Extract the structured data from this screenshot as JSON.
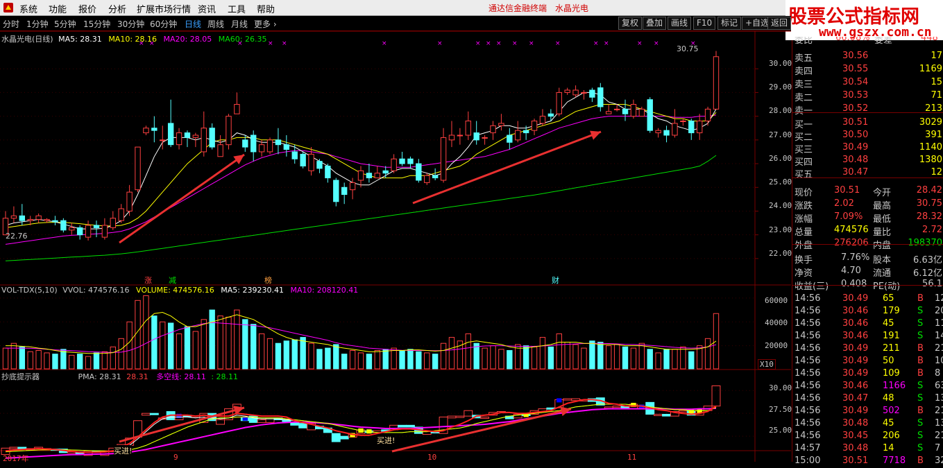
{
  "menu": {
    "items": [
      "系统",
      "功能",
      "报价",
      "分析",
      "扩展市场行情",
      "资讯",
      "工具",
      "帮助"
    ],
    "app_title": "通达信金融终端",
    "stock_title": "水晶光电"
  },
  "logo": {
    "line1": "股票公式指标网",
    "line2": "www.gszx.com.cn"
  },
  "toolbar": {
    "periods": [
      "分时",
      "1分钟",
      "5分钟",
      "15分钟",
      "30分钟",
      "60分钟",
      "日线",
      "周线",
      "月线",
      "更多 ›"
    ],
    "active_period": "日线",
    "buttons": [
      "复权",
      "叠加",
      "画线",
      "F10",
      "标记",
      "+自选",
      "返回"
    ]
  },
  "main_chart": {
    "title": "水晶光电(日线)",
    "ma5": "MA5: 28.31",
    "ma10": "MA10: 28.16",
    "ma20": "MA20: 28.05",
    "ma60": "MA60: 26.35",
    "high_label": "30.75",
    "low_label": "22.76",
    "event_markers": [
      "涨",
      "减",
      "榜",
      "财"
    ],
    "y_ticks": [
      "30.00",
      "29.00",
      "28.00",
      "27.00",
      "26.00",
      "25.00",
      "24.00",
      "23.00",
      "22.00"
    ]
  },
  "volume_panel": {
    "title": "VOL-TDX(5,10)",
    "vvol": "VVOL: 474576.16",
    "volume": "VOLUME: 474576.16",
    "ma5": "MA5: 239230.41",
    "ma10": "MA10: 208120.41",
    "y_ticks": [
      "60000",
      "40000",
      "20000"
    ],
    "unit": "X10"
  },
  "indicator_panel": {
    "title": "抄底提示器",
    "pma": "PMA: 28.31",
    "pma_val2": "28.31",
    "dk_label": "多空线: 28.11",
    "dk_val2": ": 28.11",
    "buy_signals": [
      "买进!",
      "买进!"
    ],
    "y_ticks": [
      "30.00",
      "27.50",
      "25.00"
    ]
  },
  "x_axis": {
    "labels": [
      "2017年",
      "9",
      "10",
      "11"
    ]
  },
  "quote_panel": {
    "header_partial": [
      "委比",
      "66.08%",
      "委差",
      "448"
    ],
    "sell": [
      {
        "label": "卖五",
        "price": "30.56",
        "vol": "17"
      },
      {
        "label": "卖四",
        "price": "30.55",
        "vol": "1169"
      },
      {
        "label": "卖三",
        "price": "30.54",
        "vol": "15"
      },
      {
        "label": "卖二",
        "price": "30.53",
        "vol": "71"
      },
      {
        "label": "卖一",
        "price": "30.52",
        "vol": "213"
      }
    ],
    "buy": [
      {
        "label": "买一",
        "price": "30.51",
        "vol": "3029"
      },
      {
        "label": "买二",
        "price": "30.50",
        "vol": "391"
      },
      {
        "label": "买三",
        "price": "30.49",
        "vol": "1140"
      },
      {
        "label": "买四",
        "price": "30.48",
        "vol": "1380"
      },
      {
        "label": "买五",
        "price": "30.47",
        "vol": "12"
      }
    ],
    "stats": [
      {
        "l1": "现价",
        "v1": "30.51",
        "l2": "今开",
        "v2": "28.42"
      },
      {
        "l1": "涨跌",
        "v1": "2.02",
        "l2": "最高",
        "v2": "30.75"
      },
      {
        "l1": "涨幅",
        "v1": "7.09%",
        "l2": "最低",
        "v2": "28.32"
      },
      {
        "l1": "总量",
        "v1": "474576",
        "l2": "量比",
        "v2": "2.72"
      },
      {
        "l1": "外盘",
        "v1": "276206",
        "l2": "内盘",
        "v2": "198370"
      }
    ],
    "fin": [
      {
        "l1": "换手",
        "v1": "7.76%",
        "l2": "股本",
        "v2": "6.63亿"
      },
      {
        "l1": "净资",
        "v1": "4.70",
        "l2": "流通",
        "v2": "6.12亿"
      },
      {
        "l1": "收益(三)",
        "v1": "0.408",
        "l2": "PE(动)",
        "v2": "56.1"
      }
    ],
    "ticks": [
      {
        "t": "14:56",
        "p": "30.49",
        "v": "65",
        "d": "B",
        "n": "12"
      },
      {
        "t": "14:56",
        "p": "30.46",
        "v": "179",
        "d": "S",
        "n": "20"
      },
      {
        "t": "14:56",
        "p": "30.46",
        "v": "45",
        "d": "S",
        "n": "11"
      },
      {
        "t": "14:56",
        "p": "30.46",
        "v": "191",
        "d": "S",
        "n": "14"
      },
      {
        "t": "14:56",
        "p": "30.49",
        "v": "211",
        "d": "B",
        "n": "21"
      },
      {
        "t": "14:56",
        "p": "30.49",
        "v": "50",
        "d": "B",
        "n": "10"
      },
      {
        "t": "14:56",
        "p": "30.49",
        "v": "109",
        "d": "B",
        "n": "8"
      },
      {
        "t": "14:56",
        "p": "30.46",
        "v": "1166",
        "d": "S",
        "n": "63"
      },
      {
        "t": "14:56",
        "p": "30.47",
        "v": "48",
        "d": "S",
        "n": "13"
      },
      {
        "t": "14:56",
        "p": "30.49",
        "v": "502",
        "d": "B",
        "n": "21"
      },
      {
        "t": "14:56",
        "p": "30.48",
        "v": "45",
        "d": "S",
        "n": "13"
      },
      {
        "t": "14:56",
        "p": "30.45",
        "v": "206",
        "d": "S",
        "n": "21"
      },
      {
        "t": "14:57",
        "p": "30.48",
        "v": "14",
        "d": "S",
        "n": "7"
      },
      {
        "t": "15:00",
        "p": "30.51",
        "v": "7718",
        "d": "B",
        "n": "32"
      }
    ]
  },
  "colors": {
    "up": "#ff4040",
    "down": "#54ffff",
    "ma5": "#ffffff",
    "ma10": "#ffff00",
    "ma20": "#ff00ff",
    "ma60": "#00e000",
    "panel_border": "#7a0000",
    "arrow": "#e83030"
  },
  "chart_data": {
    "type": "candlestick",
    "title": "水晶光电(日线)",
    "candles": [
      [
        23.0,
        23.7,
        23.0,
        24.0
      ],
      [
        23.7,
        23.8,
        23.5,
        24.2
      ],
      [
        23.8,
        23.6,
        23.4,
        24.3
      ],
      [
        23.6,
        23.65,
        23.4,
        23.8
      ],
      [
        23.65,
        23.8,
        23.5,
        23.9
      ],
      [
        23.6,
        23.65,
        23.5,
        23.7
      ],
      [
        23.6,
        23.55,
        23.4,
        23.8
      ],
      [
        23.6,
        23.2,
        23.1,
        23.7
      ],
      [
        23.2,
        23.3,
        23.0,
        23.5
      ],
      [
        23.3,
        23.0,
        22.8,
        23.4
      ],
      [
        22.9,
        23.4,
        22.76,
        23.6
      ],
      [
        23.4,
        23.3,
        22.9,
        23.6
      ],
      [
        22.9,
        23.4,
        22.8,
        23.7
      ],
      [
        23.3,
        23.7,
        23.2,
        24.0
      ],
      [
        23.6,
        24.1,
        23.5,
        24.3
      ],
      [
        24.0,
        24.8,
        23.8,
        25.1
      ],
      [
        24.9,
        26.7,
        24.8,
        26.7
      ],
      [
        27.3,
        27.5,
        27.2,
        27.6
      ],
      [
        27.5,
        27.4,
        26.9,
        28.0
      ],
      [
        27.0,
        27.0,
        26.6,
        27.6
      ],
      [
        27.7,
        26.8,
        26.7,
        28.7
      ],
      [
        26.8,
        27.3,
        26.6,
        27.5
      ],
      [
        27.3,
        27.1,
        26.7,
        27.4
      ],
      [
        27.1,
        27.2,
        26.7,
        27.3
      ],
      [
        26.5,
        27.5,
        26.3,
        28.2
      ],
      [
        27.5,
        26.7,
        26.6,
        27.7
      ],
      [
        26.3,
        26.8,
        26.3,
        27.2
      ],
      [
        26.8,
        28.0,
        26.6,
        28.1
      ],
      [
        28.1,
        28.5,
        28.1,
        29.0
      ],
      [
        27.0,
        26.7,
        26.5,
        27.2
      ],
      [
        27.2,
        26.5,
        26.1,
        27.4
      ],
      [
        26.5,
        26.8,
        26.3,
        27.0
      ],
      [
        26.5,
        27.0,
        26.4,
        27.1
      ],
      [
        27.0,
        26.8,
        26.4,
        27.5
      ],
      [
        26.8,
        26.6,
        26.3,
        27.2
      ],
      [
        26.5,
        26.2,
        26.0,
        26.8
      ],
      [
        26.4,
        25.9,
        25.8,
        26.5
      ],
      [
        25.7,
        26.4,
        25.5,
        26.7
      ],
      [
        26.1,
        25.8,
        25.6,
        26.2
      ],
      [
        25.9,
        25.4,
        25.2,
        26.0
      ],
      [
        25.3,
        24.4,
        24.2,
        25.4
      ],
      [
        25.0,
        24.7,
        24.3,
        25.2
      ],
      [
        24.9,
        25.2,
        24.5,
        25.4
      ],
      [
        25.3,
        25.7,
        25.0,
        25.9
      ],
      [
        25.6,
        25.4,
        25.2,
        26.0
      ],
      [
        25.4,
        25.6,
        25.4,
        25.9
      ],
      [
        25.7,
        25.6,
        25.4,
        25.9
      ],
      [
        25.7,
        26.2,
        25.6,
        26.4
      ],
      [
        26.2,
        26.0,
        25.9,
        26.5
      ],
      [
        26.2,
        26.0,
        25.8,
        26.3
      ],
      [
        26.0,
        25.3,
        25.2,
        26.2
      ],
      [
        25.2,
        25.5,
        25.1,
        25.6
      ],
      [
        25.5,
        25.4,
        25.3,
        25.8
      ],
      [
        25.3,
        27.1,
        25.2,
        27.5
      ],
      [
        27.0,
        27.2,
        26.7,
        27.8
      ],
      [
        27.2,
        27.2,
        26.8,
        27.5
      ],
      [
        27.2,
        27.8,
        27.0,
        28.2
      ],
      [
        27.3,
        27.0,
        26.8,
        27.8
      ],
      [
        27.1,
        27.1,
        26.8,
        27.2
      ],
      [
        27.3,
        27.6,
        27.0,
        27.8
      ],
      [
        27.6,
        27.7,
        27.4,
        28.1
      ],
      [
        27.2,
        26.9,
        26.6,
        27.5
      ],
      [
        27.0,
        27.4,
        26.9,
        27.8
      ],
      [
        27.4,
        27.3,
        27.0,
        27.6
      ],
      [
        27.4,
        27.8,
        27.2,
        27.9
      ],
      [
        27.7,
        28.0,
        27.6,
        28.3
      ],
      [
        28.1,
        28.0,
        27.8,
        28.3
      ],
      [
        28.1,
        29.0,
        28.0,
        29.2
      ],
      [
        29.0,
        29.1,
        28.9,
        29.2
      ],
      [
        28.9,
        29.1,
        28.8,
        29.3
      ],
      [
        29.0,
        29.0,
        28.7,
        29.1
      ],
      [
        29.1,
        28.8,
        28.6,
        29.2
      ],
      [
        29.2,
        28.4,
        28.2,
        29.4
      ],
      [
        28.1,
        28.2,
        28.1,
        28.5
      ],
      [
        28.3,
        28.3,
        28.2,
        28.5
      ],
      [
        28.3,
        28.1,
        27.8,
        28.7
      ],
      [
        28.0,
        28.5,
        27.9,
        28.7
      ],
      [
        28.0,
        28.3,
        28.0,
        28.4
      ],
      [
        28.7,
        27.4,
        27.3,
        28.8
      ],
      [
        27.3,
        27.4,
        27.1,
        27.5
      ],
      [
        27.4,
        27.2,
        26.9,
        27.6
      ],
      [
        27.2,
        27.7,
        27.1,
        28.3
      ],
      [
        27.8,
        27.8,
        27.6,
        27.9
      ],
      [
        27.8,
        27.3,
        27.0,
        27.9
      ],
      [
        27.3,
        27.8,
        27.0,
        28.1
      ],
      [
        27.8,
        28.3,
        27.6,
        28.4
      ],
      [
        28.3,
        30.51,
        28.32,
        30.75
      ]
    ],
    "ma5": [
      23.4,
      23.5,
      23.55,
      23.6,
      23.65,
      23.6,
      23.55,
      23.45,
      23.35,
      23.25,
      23.25,
      23.25,
      23.28,
      23.4,
      23.6,
      24.0,
      24.7,
      25.5,
      26.3,
      26.9,
      27.1,
      27.1,
      27.1,
      27.0,
      27.1,
      27.0,
      26.9,
      27.0,
      27.3,
      27.2,
      27.0,
      26.9,
      26.9,
      26.9,
      26.8,
      26.7,
      26.5,
      26.3,
      26.1,
      25.9,
      25.6,
      25.4,
      25.2,
      25.1,
      25.1,
      25.3,
      25.5,
      25.7,
      25.8,
      25.8,
      25.7,
      25.6,
      25.5,
      25.6,
      26.0,
      26.3,
      26.7,
      27.2,
      27.3,
      27.4,
      27.6,
      27.6,
      27.5,
      27.5,
      27.6,
      27.7,
      27.8,
      28.2,
      28.6,
      28.8,
      29.0,
      29.0,
      28.9,
      28.6,
      28.5,
      28.3,
      28.3,
      28.3,
      28.1,
      27.9,
      27.8,
      27.6,
      27.5,
      27.4,
      27.5,
      27.7,
      28.3
    ],
    "ma10": [
      23.3,
      23.35,
      23.4,
      23.45,
      23.5,
      23.52,
      23.53,
      23.53,
      23.5,
      23.47,
      23.43,
      23.4,
      23.38,
      23.37,
      23.4,
      23.5,
      23.7,
      24.0,
      24.4,
      24.8,
      25.2,
      25.6,
      26.0,
      26.3,
      26.6,
      26.9,
      27.0,
      27.0,
      27.1,
      27.1,
      27.1,
      27.0,
      27.0,
      27.0,
      26.9,
      26.8,
      26.7,
      26.6,
      26.5,
      26.4,
      26.2,
      26.0,
      25.8,
      25.6,
      25.5,
      25.4,
      25.4,
      25.4,
      25.4,
      25.5,
      25.5,
      25.5,
      25.6,
      25.7,
      25.8,
      25.9,
      26.1,
      26.4,
      26.6,
      26.8,
      27.0,
      27.2,
      27.3,
      27.4,
      27.5,
      27.6,
      27.7,
      27.8,
      28.0,
      28.2,
      28.3,
      28.4,
      28.5,
      28.5,
      28.5,
      28.5,
      28.4,
      28.3,
      28.2,
      28.1,
      28.0,
      27.9,
      27.9,
      27.8,
      27.8,
      27.8,
      28.16
    ],
    "ma20": [
      22.6,
      22.65,
      22.7,
      22.75,
      22.8,
      22.85,
      22.9,
      22.95,
      22.98,
      23.0,
      23.02,
      23.04,
      23.06,
      23.1,
      23.15,
      23.25,
      23.4,
      23.55,
      23.75,
      23.95,
      24.15,
      24.35,
      24.55,
      24.75,
      24.95,
      25.15,
      25.35,
      25.55,
      25.75,
      25.95,
      26.1,
      26.25,
      26.35,
      26.45,
      26.5,
      26.55,
      26.55,
      26.5,
      26.45,
      26.4,
      26.3,
      26.2,
      26.1,
      26.0,
      25.95,
      25.9,
      25.85,
      25.85,
      25.85,
      25.85,
      25.9,
      25.95,
      26.0,
      26.05,
      26.1,
      26.15,
      26.2,
      26.25,
      26.3,
      26.4,
      26.5,
      26.6,
      26.75,
      26.9,
      27.05,
      27.2,
      27.35,
      27.5,
      27.6,
      27.7,
      27.8,
      27.9,
      27.95,
      28.0,
      28.0,
      28.0,
      28.0,
      28.0,
      28.0,
      28.0,
      28.0,
      27.95,
      27.95,
      27.95,
      28.0,
      28.0,
      28.05
    ],
    "ma60": [
      21.9,
      21.92,
      21.94,
      21.96,
      21.98,
      22.0,
      22.02,
      22.04,
      22.06,
      22.08,
      22.1,
      22.12,
      22.14,
      22.17,
      22.2,
      22.24,
      22.28,
      22.33,
      22.38,
      22.43,
      22.48,
      22.53,
      22.58,
      22.63,
      22.68,
      22.73,
      22.78,
      22.83,
      22.88,
      22.93,
      22.98,
      23.03,
      23.08,
      23.13,
      23.18,
      23.23,
      23.28,
      23.33,
      23.38,
      23.43,
      23.48,
      23.53,
      23.58,
      23.63,
      23.68,
      23.73,
      23.78,
      23.83,
      23.88,
      23.93,
      23.98,
      24.03,
      24.08,
      24.13,
      24.18,
      24.23,
      24.28,
      24.33,
      24.38,
      24.43,
      24.48,
      24.53,
      24.58,
      24.63,
      24.68,
      24.74,
      24.8,
      24.86,
      24.92,
      24.98,
      25.04,
      25.1,
      25.16,
      25.22,
      25.28,
      25.34,
      25.4,
      25.46,
      25.52,
      25.58,
      25.64,
      25.7,
      25.76,
      25.82,
      25.9,
      26.1,
      26.35
    ],
    "volume": [
      18000,
      22000,
      19000,
      15000,
      16000,
      14000,
      13000,
      17000,
      12000,
      13000,
      11000,
      14000,
      15000,
      19000,
      26000,
      40000,
      58000,
      62000,
      45000,
      40000,
      39000,
      30000,
      36000,
      32000,
      42000,
      50000,
      45000,
      44000,
      50000,
      42000,
      38000,
      30000,
      26000,
      22000,
      24000,
      25000,
      27000,
      22000,
      17000,
      18000,
      21000,
      13000,
      16000,
      14000,
      13000,
      16000,
      17000,
      18000,
      16000,
      17000,
      15000,
      14000,
      13000,
      22000,
      27000,
      24000,
      30000,
      22000,
      18000,
      20000,
      17000,
      16000,
      21000,
      20000,
      19000,
      27000,
      19000,
      30000,
      23000,
      21000,
      18000,
      24000,
      23000,
      20000,
      21000,
      19000,
      18000,
      22000,
      17000,
      14000,
      17000,
      17000,
      19000,
      15000,
      20000,
      26000,
      47000
    ],
    "vol_ma5": [
      20000,
      20000,
      19500,
      19000,
      18000,
      17200,
      16000,
      15000,
      14500,
      14000,
      13500,
      13500,
      13600,
      14200,
      17000,
      23000,
      32000,
      41000,
      47000,
      48000,
      45000,
      40000,
      36000,
      36000,
      38000,
      40000,
      42000,
      44000,
      46000,
      44000,
      42000,
      38000,
      34000,
      30000,
      27000,
      25000,
      24000,
      23000,
      22000,
      21000,
      19000,
      18000,
      17000,
      16000,
      15000,
      15000,
      15500,
      16000,
      16000,
      16500,
      16500,
      16000,
      15500,
      16000,
      18000,
      20000,
      23000,
      24000,
      23000,
      22000,
      21000,
      19000,
      18000,
      18000,
      19000,
      20000,
      21000,
      23000,
      23000,
      23000,
      22000,
      22000,
      21000,
      21000,
      21000,
      20000,
      20000,
      20000,
      19000,
      18000,
      17000,
      17000,
      17000,
      17000,
      17500,
      19000,
      23923
    ],
    "vol_ma10": [
      18000,
      18000,
      18000,
      17800,
      17500,
      17000,
      16500,
      16200,
      15800,
      15500,
      15000,
      14800,
      14500,
      14400,
      14600,
      16000,
      18500,
      22000,
      25500,
      28500,
      31000,
      33500,
      35500,
      37000,
      38500,
      39500,
      39000,
      38500,
      38000,
      37500,
      37000,
      36000,
      35000,
      33500,
      32000,
      30500,
      29000,
      27500,
      26000,
      24500,
      22500,
      21000,
      20000,
      19000,
      18000,
      17500,
      17000,
      16500,
      16200,
      16000,
      16000,
      16000,
      15800,
      16000,
      16500,
      17200,
      18200,
      19200,
      19800,
      20000,
      20000,
      19800,
      19500,
      19500,
      19500,
      19800,
      20200,
      20800,
      21200,
      21500,
      21800,
      22000,
      22000,
      21800,
      21500,
      21200,
      21000,
      20700,
      20300,
      19800,
      19200,
      18600,
      18200,
      18000,
      18200,
      19000,
      20812
    ],
    "y_range": [
      21.5,
      31.0
    ],
    "vol_range": [
      0,
      64000
    ]
  }
}
